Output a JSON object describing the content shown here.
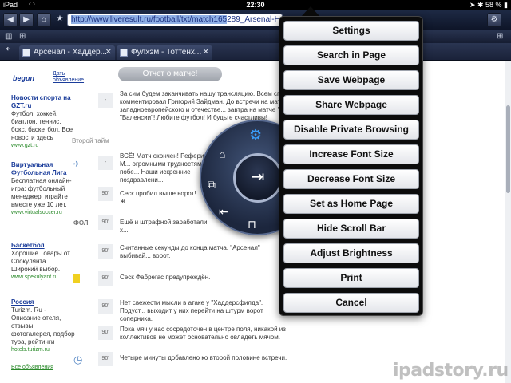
{
  "status": {
    "device": "iPad",
    "time": "22:30",
    "battery": "58 %"
  },
  "toolbar": {
    "url_selected": "http://www.liveresult.ru/football/txt/match165",
    "url_rest": "289_Arsenal-Huddersf"
  },
  "tabs": [
    {
      "label": "Арсенал - Хаддер..."
    },
    {
      "label": "Фулхэм - Тоттенх..."
    }
  ],
  "page": {
    "begun": "begun",
    "begun_link": "Дать объявление",
    "report_button": "Отчет о матче!",
    "half_label": "Второй тайм",
    "ads": [
      {
        "title": "Новости спорта на GZT.ru",
        "text": "Футбол, хоккей, биатлон, теннис, бокс, баскетбол. Все новости здесь",
        "url": "www.gzt.ru"
      },
      {
        "title": "Виртуальная Футбольная Лига",
        "text": "Бесплатная онлайн-игра: футбольный менеджер, играйте вместе уже 10 лет.",
        "url": "www.virtualsoccer.ru"
      },
      {
        "title": "Баскетбол",
        "text": "Хорошие Товары от Спокулянта. Широкий выбор.",
        "url": "www.spekulyant.ru"
      },
      {
        "title": "Россия",
        "text": "Turizm. Ru - Описание отеля, отзывы, фотогалерея, подбор тура, рейтинги",
        "url": "hotels.turizm.ru"
      }
    ],
    "all_ads": "Все объявления",
    "events": [
      {
        "min": "-",
        "text": "За сим будем заканчивать нашу трансляцию. Всем спас... матч комментировал Григорий Зайдман. До встречи на матчах западноевропейского и отечестве... завтра на матче \"Расинга\" и \"Валенсии\"! Любите футбол! И будьте счастливы!"
      },
      {
        "min": "-",
        "text": "ВСЁ! Матч окончен! Рефери М... огромными трудностями побе... Наши искренние поздравлени..."
      },
      {
        "min": "90'",
        "text": "Сеск пробил выше ворот! Ж..."
      },
      {
        "min": "90'",
        "text": "Ещё и штрафной заработали х..."
      },
      {
        "min": "90'",
        "text": "Считанные секунды до конца матча. \"Арсенал\" выбивай... ворот."
      },
      {
        "min": "90'",
        "text": "Сеск Фабрегас предупреждён."
      },
      {
        "min": "90'",
        "text": "Нет свежести мысли в атаке у \"Хаддерсфилда\". Подуст... выходит у них перейти на штурм ворот соперника."
      },
      {
        "min": "90'",
        "text": "Пока мяч у нас сосредоточен в центре поля, никакой из коллективов не может основательно овладеть мячом."
      },
      {
        "min": "90'",
        "text": "Четыре минуты добавлено ко второй половине встречи."
      }
    ],
    "fol_icon_label": "ФОЛ"
  },
  "menu": {
    "items": [
      "Settings",
      "Search in Page",
      "Save Webpage",
      "Share Webpage",
      "Disable Private Browsing",
      "Increase Font Size",
      "Decrease Font Size",
      "Set as Home Page",
      "Hide Scroll Bar",
      "Adjust Brightness",
      "Print",
      "Cancel"
    ]
  },
  "watermark": "ipadstory.ru",
  "colors": {
    "toolbar": "#1a2239",
    "menu_bg": "#0c0c0c",
    "link": "#1a3c9a",
    "ad_url": "#2a8a2a"
  }
}
